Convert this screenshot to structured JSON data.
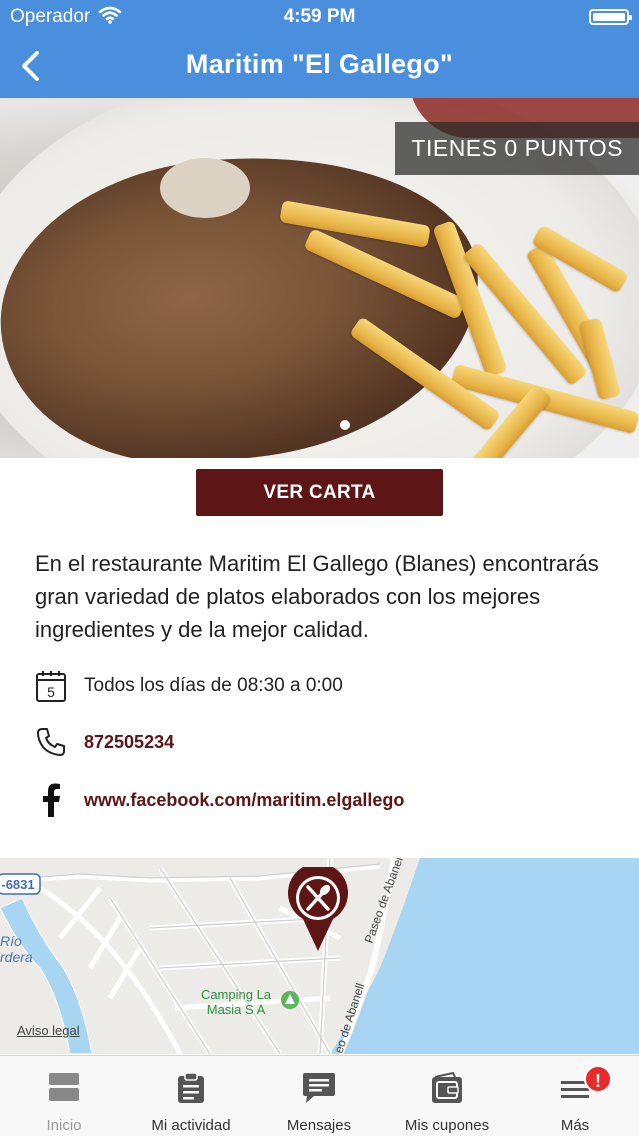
{
  "status_bar": {
    "carrier": "Operador",
    "time": "4:59 PM"
  },
  "nav": {
    "title": "Maritim \"El Gallego\""
  },
  "hero": {
    "points_badge": "TIENES 0 PUNTOS",
    "carousel_pages": 1
  },
  "menu_button": {
    "label": "VER CARTA"
  },
  "description": "En el restaurante Maritim El Gallego (Blanes) encontrarás gran variedad de platos elaborados con los mejores ingredientes y de la mejor calidad.",
  "info": {
    "calendar_day": "5",
    "schedule": "Todos los días de 08:30 a 0:00",
    "phone": "872505234",
    "facebook": "www.facebook.com/maritim.elgallego"
  },
  "map": {
    "road_label": "-6831",
    "river_label_1": "Río",
    "river_label_2": "rdera",
    "street_1": "Paseo de Abanell",
    "street_2": "eo de Abanell",
    "camping_label_1": "Camping La",
    "camping_label_2": "Masia S A",
    "legal_link": "Aviso legal"
  },
  "tabbar": {
    "tabs": [
      {
        "label": "Inicio",
        "icon": "home-cards-icon"
      },
      {
        "label": "Mi actividad",
        "icon": "clipboard-icon"
      },
      {
        "label": "Mensajes",
        "icon": "message-icon"
      },
      {
        "label": "Mis cupones",
        "icon": "wallet-icon"
      },
      {
        "label": "Más",
        "icon": "menu-icon"
      }
    ],
    "more_badge": "!"
  },
  "colors": {
    "nav_blue": "#4a8fde",
    "brand_maroon": "#5e1515",
    "badge_red": "#e82a2a",
    "sea_blue": "#a7d5f2"
  }
}
